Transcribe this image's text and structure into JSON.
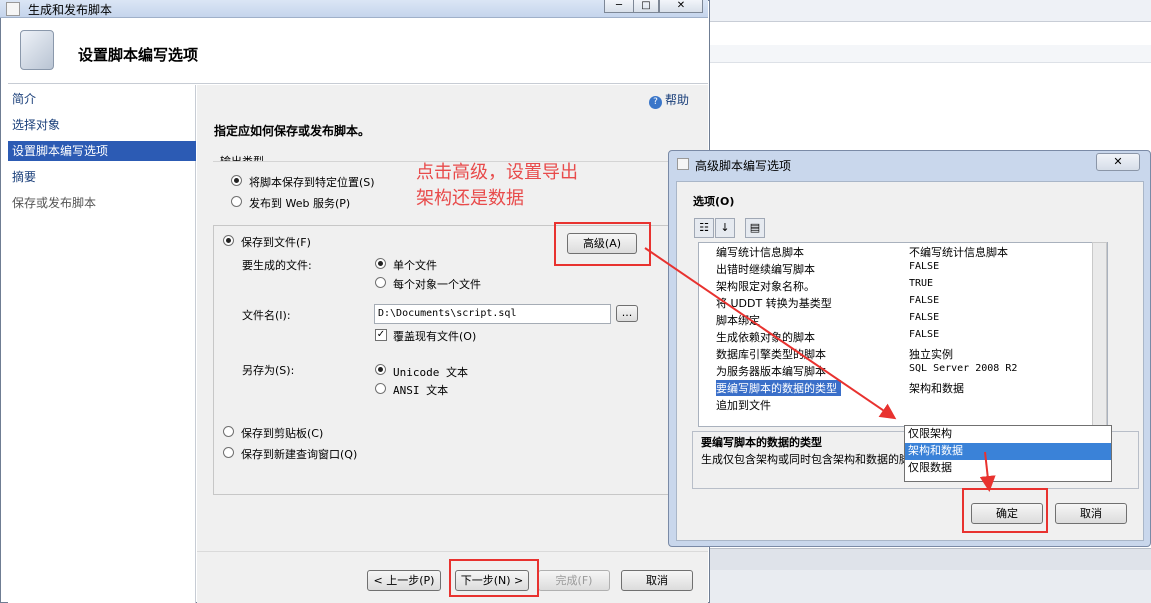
{
  "wizard": {
    "title": "生成和发布脚本",
    "header_title": "设置脚本编写选项",
    "sidebar": [
      "简介",
      "选择对象",
      "设置脚本编写选项",
      "摘要",
      "保存或发布脚本"
    ],
    "help": "帮助",
    "instruction": "指定应如何保存或发布脚本。",
    "output_type": {
      "label": "输出类型",
      "opt_save": "将脚本保存到特定位置(S)",
      "opt_publish": "发布到 Web 服务(P)"
    },
    "save_to_file": "保存到文件(F)",
    "advanced_btn": "高级(A)",
    "files_to_generate_label": "要生成的文件:",
    "single_file": "单个文件",
    "file_per_object": "每个对象一个文件",
    "file_name_label": "文件名(I):",
    "file_name_value": "D:\\Documents\\script.sql",
    "browse_btn": "...",
    "overwrite": "覆盖现有文件(O)",
    "save_as_label": "另存为(S):",
    "unicode_text": "Unicode 文本",
    "ansi_text": "ANSI 文本",
    "save_clipboard": "保存到剪贴板(C)",
    "save_new_query": "保存到新建查询窗口(Q)",
    "btn_prev": "< 上一步(P)",
    "btn_next": "下一步(N) >",
    "btn_finish": "完成(F)",
    "btn_cancel": "取消"
  },
  "annotation": {
    "line1": "点击高级，设置导出",
    "line2": "架构还是数据",
    "color": "#e84b4b"
  },
  "advanced": {
    "title": "高级脚本编写选项",
    "close": "✕",
    "options_label": "选项(O)",
    "rows": [
      {
        "key": "编写统计信息脚本",
        "value": "不编写统计信息脚本"
      },
      {
        "key": "出错时继续编写脚本",
        "value": "FALSE"
      },
      {
        "key": "架构限定对象名称。",
        "value": "TRUE"
      },
      {
        "key": "将 UDDT 转换为基类型",
        "value": "FALSE"
      },
      {
        "key": "脚本绑定",
        "value": "FALSE"
      },
      {
        "key": "生成依赖对象的脚本",
        "value": "FALSE"
      },
      {
        "key": "数据库引擎类型的脚本",
        "value": "独立实例"
      },
      {
        "key": "为服务器版本编写脚本",
        "value": "SQL Server 2008 R2"
      },
      {
        "key": "要编写脚本的数据的类型",
        "value": "架构和数据"
      },
      {
        "key": "追加到文件",
        "value": ""
      }
    ],
    "dropdown_options": [
      "仅限架构",
      "架构和数据",
      "仅限数据"
    ],
    "dropdown_selected": "架构和数据",
    "desc_title": "要编写脚本的数据的类型",
    "desc_text": "生成仅包含架构或同时包含架构和数据的脚本。",
    "btn_ok": "确定",
    "btn_cancel": "取消"
  }
}
